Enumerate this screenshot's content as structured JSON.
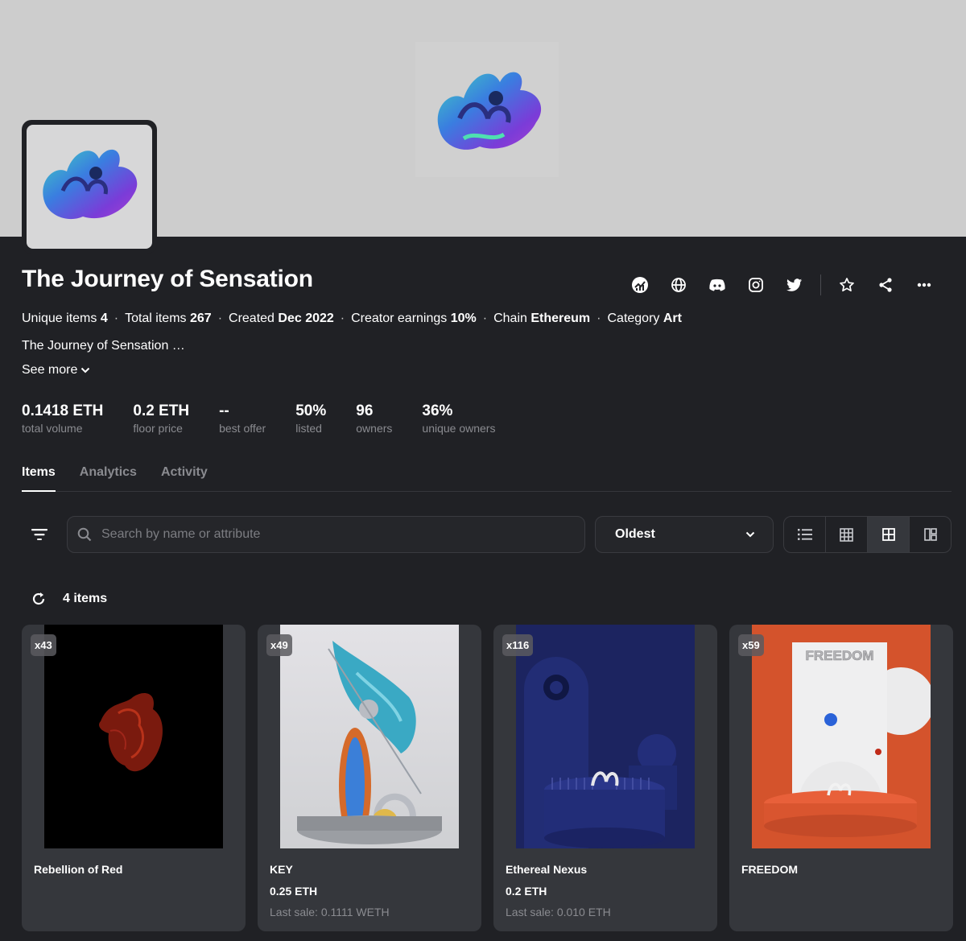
{
  "collection": {
    "name": "The Journey of Sensation",
    "meta": [
      {
        "label": "Unique items",
        "value": "4"
      },
      {
        "label": "Total items",
        "value": "267"
      },
      {
        "label": "Created",
        "value": "Dec 2022"
      },
      {
        "label": "Creator earnings",
        "value": "10%"
      },
      {
        "label": "Chain",
        "value": "Ethereum"
      },
      {
        "label": "Category",
        "value": "Art"
      }
    ],
    "description": "The Journey of Sensation …",
    "see_more": "See more"
  },
  "header_icons": [
    "stats-chart-icon",
    "globe-icon",
    "discord-icon",
    "instagram-icon",
    "twitter-icon",
    "star-icon",
    "share-icon",
    "more-icon"
  ],
  "stats": [
    {
      "value": "0.1418 ETH",
      "label": "total volume"
    },
    {
      "value": "0.2 ETH",
      "label": "floor price"
    },
    {
      "value": "--",
      "label": "best offer"
    },
    {
      "value": "50%",
      "label": "listed"
    },
    {
      "value": "96",
      "label": "owners"
    },
    {
      "value": "36%",
      "label": "unique owners"
    }
  ],
  "tabs": [
    {
      "label": "Items",
      "active": true
    },
    {
      "label": "Analytics",
      "active": false
    },
    {
      "label": "Activity",
      "active": false
    }
  ],
  "toolbar": {
    "search_placeholder": "Search by name or attribute",
    "sort_value": "Oldest",
    "views": [
      "list-view-icon",
      "grid-small-icon",
      "grid-large-icon",
      "mosaic-icon"
    ],
    "active_view": "grid-large-icon"
  },
  "items_count": "4 items",
  "items": [
    {
      "badge": "x43",
      "name": "Rebellion of Red",
      "price": "",
      "last_sale": ""
    },
    {
      "badge": "x49",
      "name": "KEY",
      "price": "0.25 ETH",
      "last_sale": "Last sale: 0.1111 WETH"
    },
    {
      "badge": "x116",
      "name": "Ethereal Nexus",
      "price": "0.2 ETH",
      "last_sale": "Last sale: 0.010 ETH"
    },
    {
      "badge": "x59",
      "name": "FREEDOM",
      "price": "",
      "last_sale": ""
    }
  ],
  "artwork_text": {
    "freedom_sign": "FREEDOM"
  },
  "colors": {
    "background": "#202125",
    "card": "#35373c",
    "banner": "#cdcdcd",
    "muted": "#8a8b90",
    "accent_red": "#e0522d",
    "accent_blue": "#1e2a7a"
  }
}
